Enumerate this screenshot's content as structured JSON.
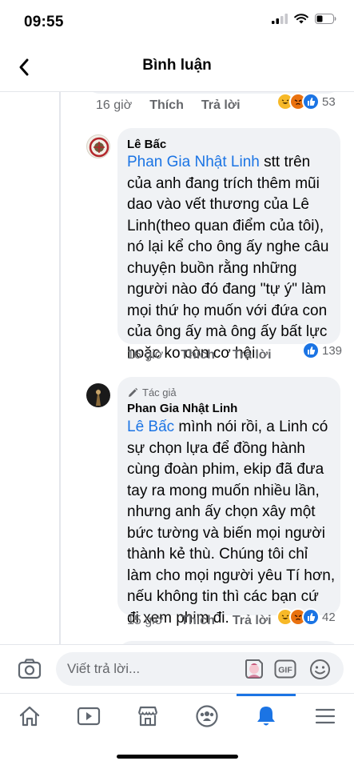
{
  "status_bar": {
    "time": "09:55"
  },
  "header": {
    "title": "Bình luận"
  },
  "prev_comment": {
    "time": "16 giờ",
    "like": "Thích",
    "reply": "Trả lời",
    "reaction_count": "53"
  },
  "comments": [
    {
      "author": "Lê Bấc",
      "mention": "Phan Gia Nhật Linh",
      "text": " stt trên\ncủa anh đang trích thêm mũi\ndao vào vết thương của Lê\nLinh(theo quan điểm của tôi),\nnó lại kể cho ông ấy nghe câu\nchuyện buồn rằng những\nngười nào đó đang \"tự ý\" làm\nmọi thứ họ muốn với đứa con\ncủa ông ấy mà ông ấy bất lực\nhoặc ko còn cơ hội",
      "time": "16 giờ",
      "like": "Thích",
      "reply": "Trả lời",
      "reaction_count": "139"
    },
    {
      "badge": "Tác giả",
      "author": "Phan Gia Nhật Linh",
      "mention": "Lê Bấc",
      "text": " mình nói rồi, a Linh có\nsự chọn lựa để đồng hành\ncùng đoàn phim, ekip đã đưa\ntay ra mong muốn nhiều lần,\nnhưng anh ấy chọn xây một\nbức tường và biến mọi người\nthành kẻ thù. Chúng tôi chỉ\nlàm cho mọi người yêu Tí hơn,\nnếu không tin thì các bạn cứ\nđi xem phim đi.",
      "time": "15 giờ",
      "like": "Thích",
      "reply": "Trả lời",
      "reaction_count": "42"
    }
  ],
  "composer": {
    "placeholder": "Viết trả lời..."
  },
  "tabbar": {
    "tabs": [
      "home-icon",
      "watch-icon",
      "marketplace-icon",
      "groups-icon",
      "notifications-icon",
      "menu-icon"
    ],
    "active": "notifications-icon"
  },
  "colors": {
    "accent": "#1b74e4",
    "bubble": "#f0f2f5",
    "muted": "#65676b"
  }
}
